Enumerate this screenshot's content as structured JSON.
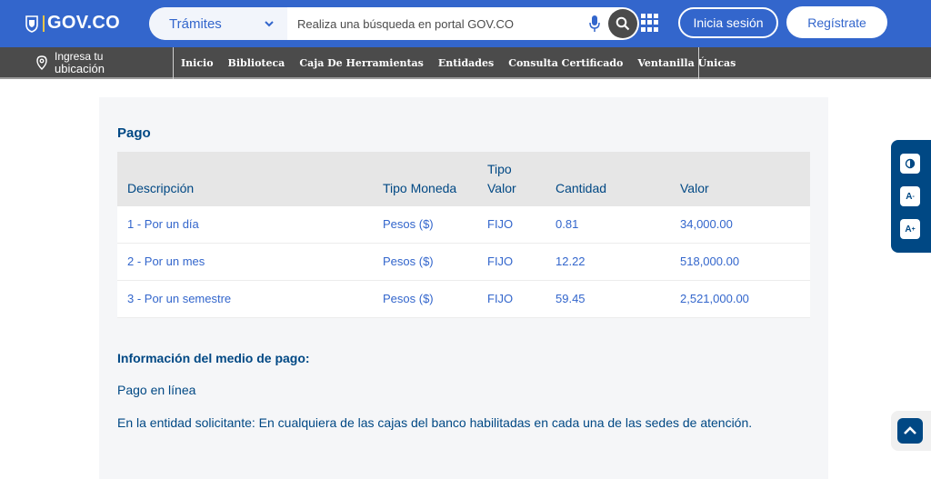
{
  "header": {
    "logo_text": "GOV.CO",
    "search_category": "Trámites",
    "search_placeholder": "Realiza una búsqueda en portal GOV.CO",
    "login_label": "Inicia sesión",
    "register_label": "Regístrate",
    "brand_color": "#3366cc"
  },
  "navbar": {
    "location_line1": "Ingresa tu",
    "location_line2": "ubicación",
    "items": [
      "Inicio",
      "Biblioteca",
      "Caja De Herramientas",
      "Entidades",
      "Consulta Certificado",
      "Ventanilla Únicas"
    ]
  },
  "pago": {
    "title": "Pago",
    "columns": {
      "descripcion": "Descripción",
      "tipo_moneda": "Tipo Moneda",
      "tipo_valor_1": "Tipo",
      "tipo_valor_2": "Valor",
      "cantidad": "Cantidad",
      "valor": "Valor"
    },
    "rows": [
      {
        "descripcion": "1 - Por un día",
        "tipo_moneda": "Pesos ($)",
        "tipo_valor": "FIJO",
        "cantidad": "0.81",
        "valor": "34,000.00"
      },
      {
        "descripcion": "2 - Por un mes",
        "tipo_moneda": "Pesos ($)",
        "tipo_valor": "FIJO",
        "cantidad": "12.22",
        "valor": "518,000.00"
      },
      {
        "descripcion": "3 - Por un semestre",
        "tipo_moneda": "Pesos ($)",
        "tipo_valor": "FIJO",
        "cantidad": "59.45",
        "valor": "2,521,000.00"
      }
    ]
  },
  "info": {
    "title": "Información del medio de pago:",
    "line1": "Pago en línea",
    "line2": "En la entidad solicitante: En cualquiera de las cajas del banco habilitadas en cada una de las sedes de atención."
  },
  "accessibility": {
    "contrast_icon": "contrast-icon",
    "decrease_label": "A",
    "increase_label": "A"
  }
}
